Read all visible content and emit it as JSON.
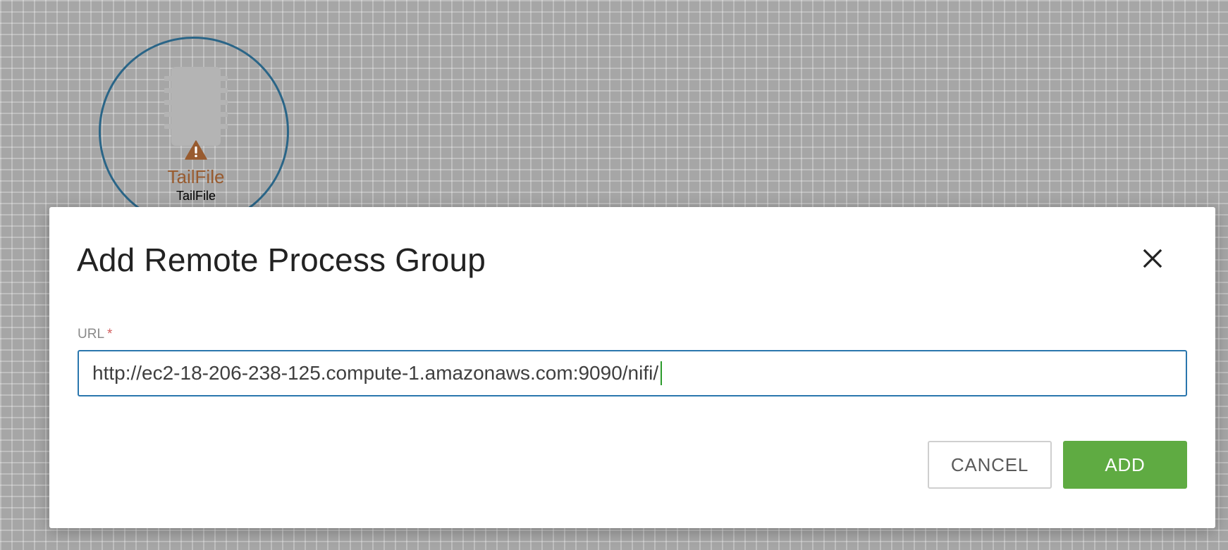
{
  "canvas": {
    "processor": {
      "name": "TailFile",
      "type": "TailFile",
      "icons": {
        "chip": "processor-chip-icon",
        "status": "warning-icon"
      },
      "colors": {
        "selection_ring": "#2a6587",
        "name": "#985b2f",
        "warning": "#985b2f"
      }
    }
  },
  "dialog": {
    "title": "Add Remote Process Group",
    "close_icon": "close-icon",
    "url_field": {
      "label": "URL",
      "required_marker": "*",
      "value": "http://ec2-18-206-238-125.compute-1.amazonaws.com:9090/nifi/"
    },
    "buttons": {
      "cancel_label": "CANCEL",
      "add_label": "ADD"
    },
    "colors": {
      "primary_button": "#5fab42",
      "input_border": "#2a76ad",
      "required": "#d25e5e"
    }
  }
}
